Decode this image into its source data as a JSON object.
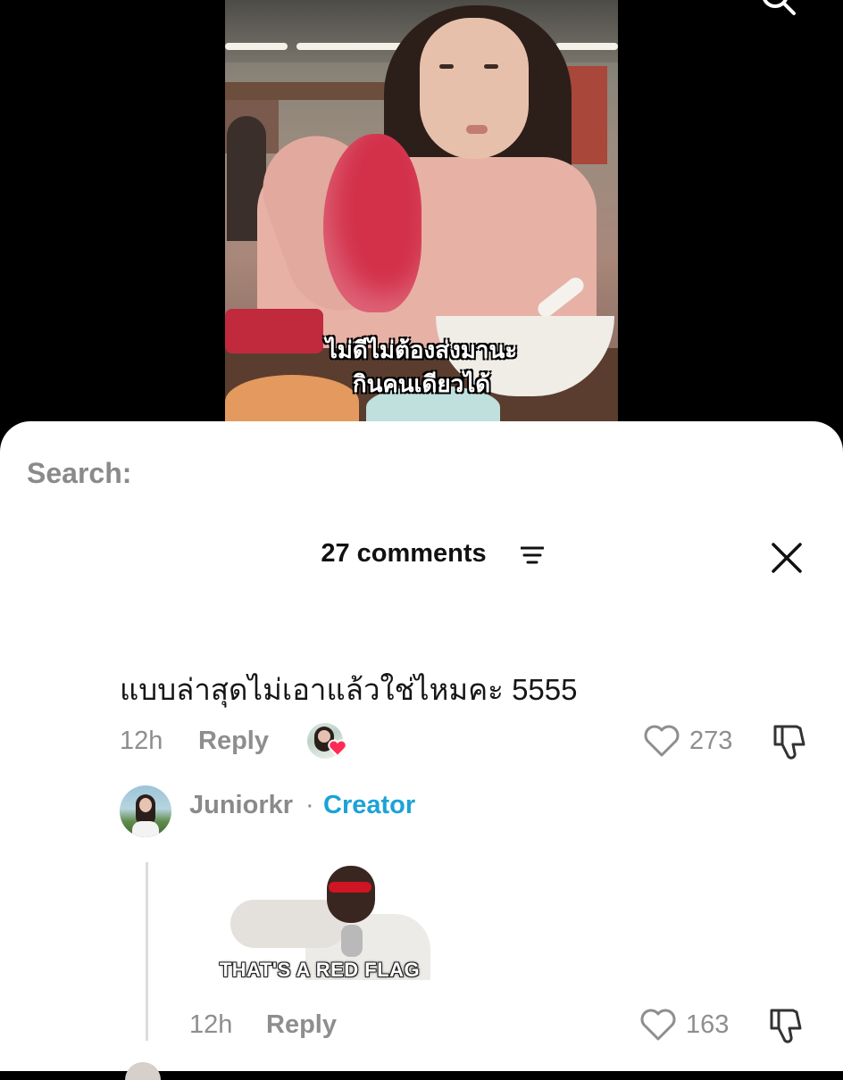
{
  "video": {
    "subtitle_line1": "ไม่ดีไม่ต้องส่งมานะ",
    "subtitle_line2": "กินคนเดียวได้"
  },
  "search": {
    "label": "Search:"
  },
  "comments_panel": {
    "title": "27 comments",
    "filter_icon": "filter-icon",
    "close_icon": "close-icon"
  },
  "comments": [
    {
      "text": "แบบล่าสุดไม่เอาแล้วใช่ไหมคะ 5555",
      "time": "12h",
      "reply_label": "Reply",
      "likes": "273",
      "liked_by_creator": true,
      "replies": [
        {
          "author": "Juniorkr",
          "separator": "·",
          "badge": "Creator",
          "gif_caption": "THAT'S A RED FLAG",
          "time": "12h",
          "reply_label": "Reply",
          "likes": "163"
        }
      ]
    }
  ],
  "colors": {
    "accent_creator": "#1ca2d6",
    "heart_red": "#fe2c55",
    "muted_text": "#8e8e8e"
  }
}
